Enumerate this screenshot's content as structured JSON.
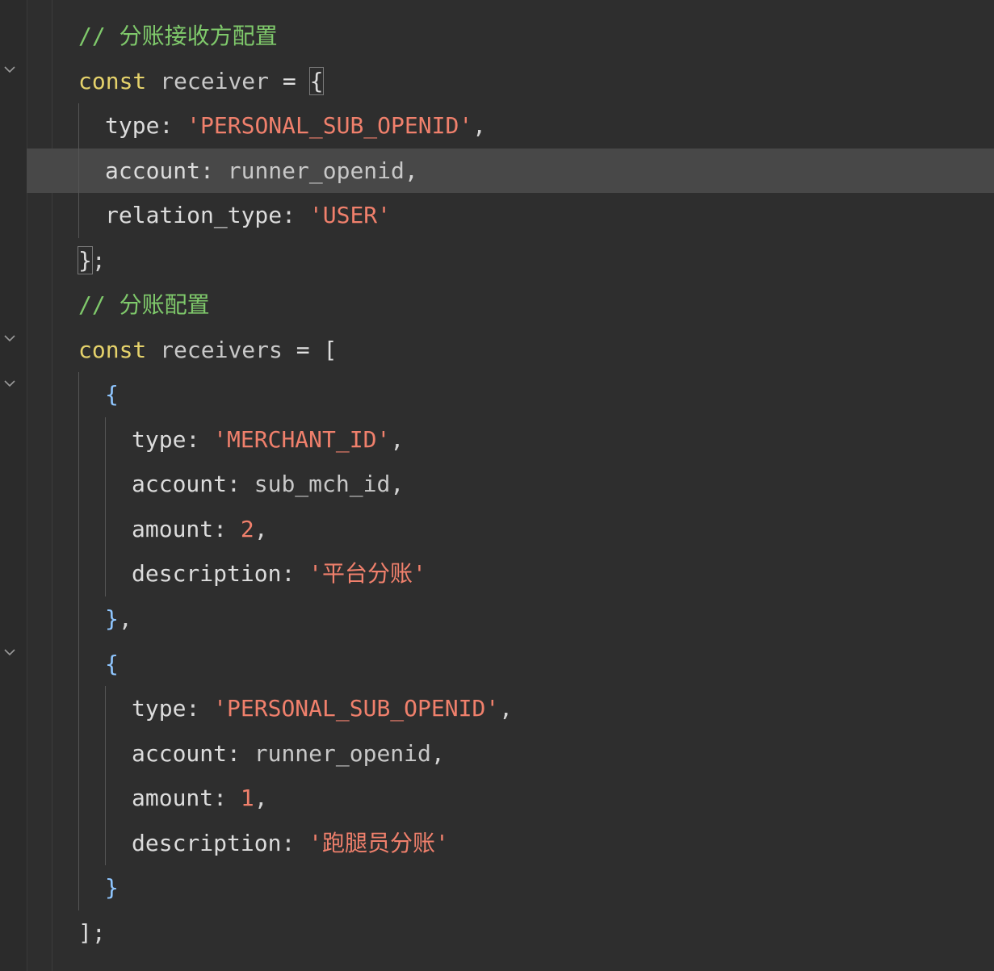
{
  "lines": [
    {
      "comment": "// 分账接收方配置"
    },
    {
      "keyword": "const",
      "name": "receiver",
      "eq": "=",
      "open": "{"
    },
    {
      "key": "type",
      "colon": ":",
      "quote_open": "'",
      "value": "PERSONAL_SUB_OPENID",
      "quote_close": "'",
      "comma": ","
    },
    {
      "key": "account",
      "colon": ":",
      "value": "runner_openid",
      "comma": ","
    },
    {
      "key": "relation_type",
      "colon": ":",
      "quote_open": "'",
      "value": "USER",
      "quote_close": "'"
    },
    {
      "close": "}",
      "semi": ";"
    },
    {
      "comment": "// 分账配置"
    },
    {
      "keyword": "const",
      "name": "receivers",
      "eq": "=",
      "open": "["
    },
    {
      "open": "{"
    },
    {
      "key": "type",
      "colon": ":",
      "quote_open": "'",
      "value": "MERCHANT_ID",
      "quote_close": "'",
      "comma": ","
    },
    {
      "key": "account",
      "colon": ":",
      "value": "sub_mch_id",
      "comma": ","
    },
    {
      "key": "amount",
      "colon": ":",
      "value": "2",
      "comma": ","
    },
    {
      "key": "description",
      "colon": ":",
      "quote_open": "'",
      "value": "平台分账",
      "quote_close": "'"
    },
    {
      "close": "}",
      "comma": ","
    },
    {
      "open": "{"
    },
    {
      "key": "type",
      "colon": ":",
      "quote_open": "'",
      "value": "PERSONAL_SUB_OPENID",
      "quote_close": "'",
      "comma": ","
    },
    {
      "key": "account",
      "colon": ":",
      "value": "runner_openid",
      "comma": ","
    },
    {
      "key": "amount",
      "colon": ":",
      "value": "1",
      "comma": ","
    },
    {
      "key": "description",
      "colon": ":",
      "quote_open": "'",
      "value": "跑腿员分账",
      "quote_close": "'"
    },
    {
      "close": "}"
    },
    {
      "close": "]",
      "semi": ";"
    }
  ],
  "active_line": 4,
  "icons": {
    "fold": "chevron-down-icon"
  },
  "colors": {
    "background": "#2e2e2e",
    "keyword": "#e5d26b",
    "string": "#f0806c",
    "comment": "#7fc96b",
    "bracket": "#8fc6ff",
    "active_line": "#484848"
  }
}
